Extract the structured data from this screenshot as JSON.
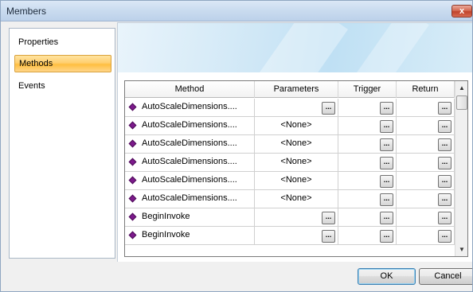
{
  "window": {
    "title": "Members",
    "close_label": "x"
  },
  "sidebar": {
    "items": [
      {
        "label": "Properties",
        "selected": false
      },
      {
        "label": "Methods",
        "selected": true
      },
      {
        "label": "Events",
        "selected": false
      }
    ]
  },
  "grid": {
    "columns": [
      "Method",
      "Parameters",
      "Trigger",
      "Return"
    ],
    "ellipsis_label": "...",
    "rows": [
      {
        "method": "AutoScaleDimensions....",
        "parameters": ""
      },
      {
        "method": "AutoScaleDimensions....",
        "parameters": "<None>"
      },
      {
        "method": "AutoScaleDimensions....",
        "parameters": "<None>"
      },
      {
        "method": "AutoScaleDimensions....",
        "parameters": "<None>"
      },
      {
        "method": "AutoScaleDimensions....",
        "parameters": "<None>"
      },
      {
        "method": "AutoScaleDimensions....",
        "parameters": "<None>"
      },
      {
        "method": "BeginInvoke",
        "parameters": ""
      },
      {
        "method": "BeginInvoke",
        "parameters": ""
      }
    ]
  },
  "buttons": {
    "ok": "OK",
    "cancel": "Cancel"
  },
  "icons": {
    "method": "method-diamond-icon",
    "close": "close-icon"
  },
  "colors": {
    "selection": "#ffcf6f",
    "method_icon": "#7d1a8c",
    "close": "#c0432b"
  }
}
